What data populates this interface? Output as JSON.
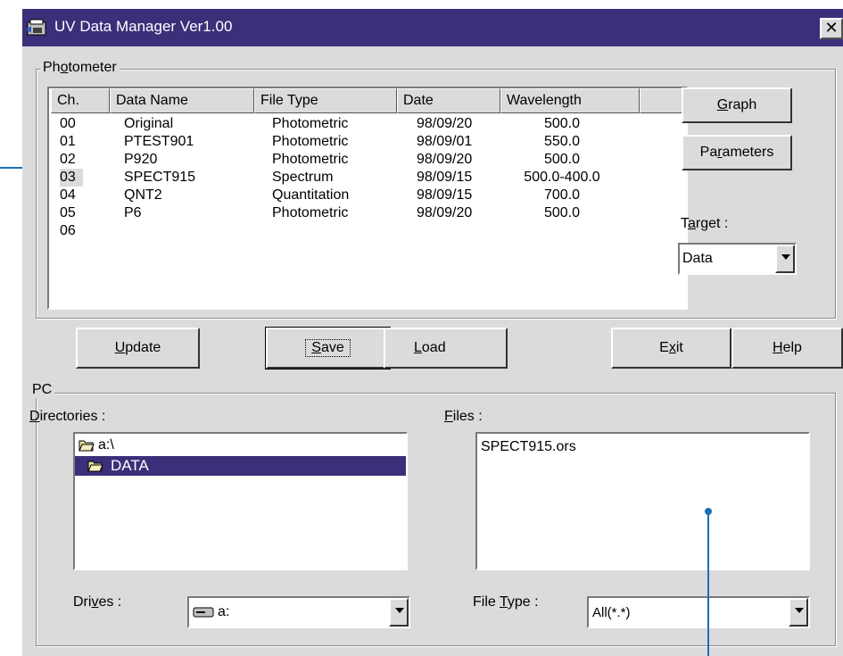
{
  "window": {
    "title": "UV Data Manager Ver1.00",
    "close_glyph": "✕"
  },
  "photometer": {
    "group_label_pre": "Ph",
    "group_label_ul": "o",
    "group_label_post": "tometer",
    "columns": [
      "Ch.",
      "Data Name",
      "File Type",
      "Date",
      "Wavelength"
    ],
    "rows": [
      {
        "ch": "00",
        "name": "Original",
        "type": "Photometric",
        "date": "98/09/20",
        "wl": "500.0"
      },
      {
        "ch": "01",
        "name": "PTEST901",
        "type": "Photometric",
        "date": "98/09/01",
        "wl": "550.0"
      },
      {
        "ch": "02",
        "name": "P920",
        "type": "Photometric",
        "date": "98/09/20",
        "wl": "500.0"
      },
      {
        "ch": "03",
        "name": "SPECT915",
        "type": "Spectrum",
        "date": "98/09/15",
        "wl": "500.0-400.0"
      },
      {
        "ch": "04",
        "name": "QNT2",
        "type": "Quantitation",
        "date": "98/09/15",
        "wl": "700.0"
      },
      {
        "ch": "05",
        "name": "P6",
        "type": "Photometric",
        "date": "98/09/20",
        "wl": "500.0"
      },
      {
        "ch": "06",
        "name": "",
        "type": "",
        "date": "",
        "wl": ""
      }
    ],
    "graph_pre": "",
    "graph_ul": "G",
    "graph_post": "raph",
    "params_pre": "Pa",
    "params_ul": "r",
    "params_post": "ameters",
    "target_pre": "T",
    "target_ul": "a",
    "target_post": "rget :",
    "target_value": "Data"
  },
  "buttons": {
    "update_ul": "U",
    "update_post": "pdate",
    "save_ul": "S",
    "save_post": "ave",
    "load_ul": "L",
    "load_post": "oad",
    "exit_pre": "E",
    "exit_ul": "x",
    "exit_post": "it",
    "help_ul": "H",
    "help_post": "elp"
  },
  "pc": {
    "group_label": "PC",
    "directories_ul": "D",
    "directories_post": "irectories :",
    "files_ul": "F",
    "files_post": "iles :",
    "dirs": [
      "a:\\",
      "DATA"
    ],
    "files": [
      "SPECT915.ors"
    ],
    "drives_pre": "Dri",
    "drives_ul": "v",
    "drives_post": "es :",
    "drive_value": "a:",
    "filetype_pre": "File ",
    "filetype_ul": "T",
    "filetype_post": "ype :",
    "filetype_value": "All(*.*)"
  },
  "colors": {
    "titlebar": "#3c2f7a",
    "selection": "#3c2f7a",
    "callout": "#1a6fb5",
    "face": "#dbdbdb"
  }
}
